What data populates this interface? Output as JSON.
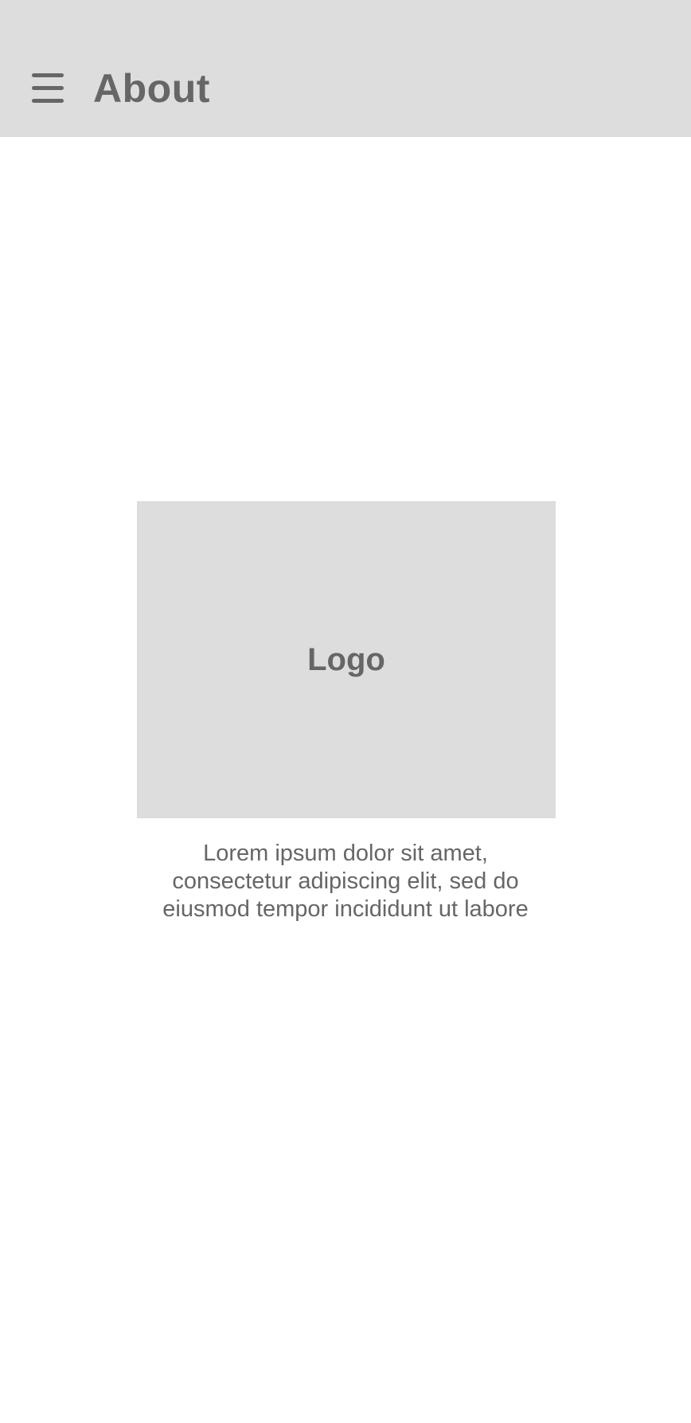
{
  "app_bar": {
    "menu_icon": "hamburger-menu-icon",
    "title": "About",
    "background_color": "#dddddd",
    "text_color": "#666666"
  },
  "main": {
    "logo_placeholder": {
      "label": "Logo",
      "background_color": "#dddddd"
    },
    "description_lines": [
      "Lorem ipsum dolor sit amet,",
      "consectetur adipiscing elit, sed do",
      "eiusmod tempor incididunt ut labore"
    ]
  }
}
